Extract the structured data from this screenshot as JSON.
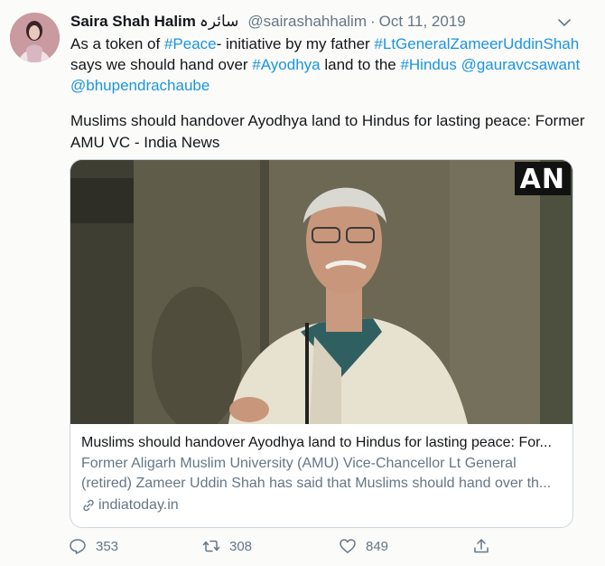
{
  "tweet": {
    "name": "Saira Shah Halim",
    "name_urdu": "سائرہ",
    "handle": "@sairashahhalim",
    "separator": "·",
    "date": "Oct 11, 2019",
    "text": {
      "p1": "As a token of ",
      "tag_peace": "#Peace",
      "p2": "- initiative by my father ",
      "tag_general": "#LtGeneralZameerUddinShah",
      "p3": " says we should hand over ",
      "tag_ayodhya": "#Ayodhya",
      "p4": " land to the ",
      "tag_hindus": "#Hindus",
      "p5": " ",
      "mention_1": "@gauravcsawant",
      "mention_2": "@bhupendrachaube"
    },
    "text_2": "Muslims should handover Ayodhya land to Hindus for lasting peace: Former AMU VC - India News"
  },
  "card": {
    "logo": "AN",
    "title": "Muslims should handover Ayodhya land to Hindus for lasting peace: For...",
    "description": "Former Aligarh Muslim University (AMU) Vice-Chancellor Lt General (retired) Zameer Uddin Shah has said that Muslims should hand over th...",
    "domain": "indiatoday.in"
  },
  "actions": {
    "reply_count": "353",
    "retweet_count": "308",
    "like_count": "849"
  },
  "colors": {
    "link": "#1b95e0",
    "secondary": "#657786",
    "border": "#ccd6dd"
  },
  "icons": [
    "chevron-down-icon",
    "reply-icon",
    "retweet-icon",
    "like-icon",
    "share-icon",
    "link-icon"
  ]
}
